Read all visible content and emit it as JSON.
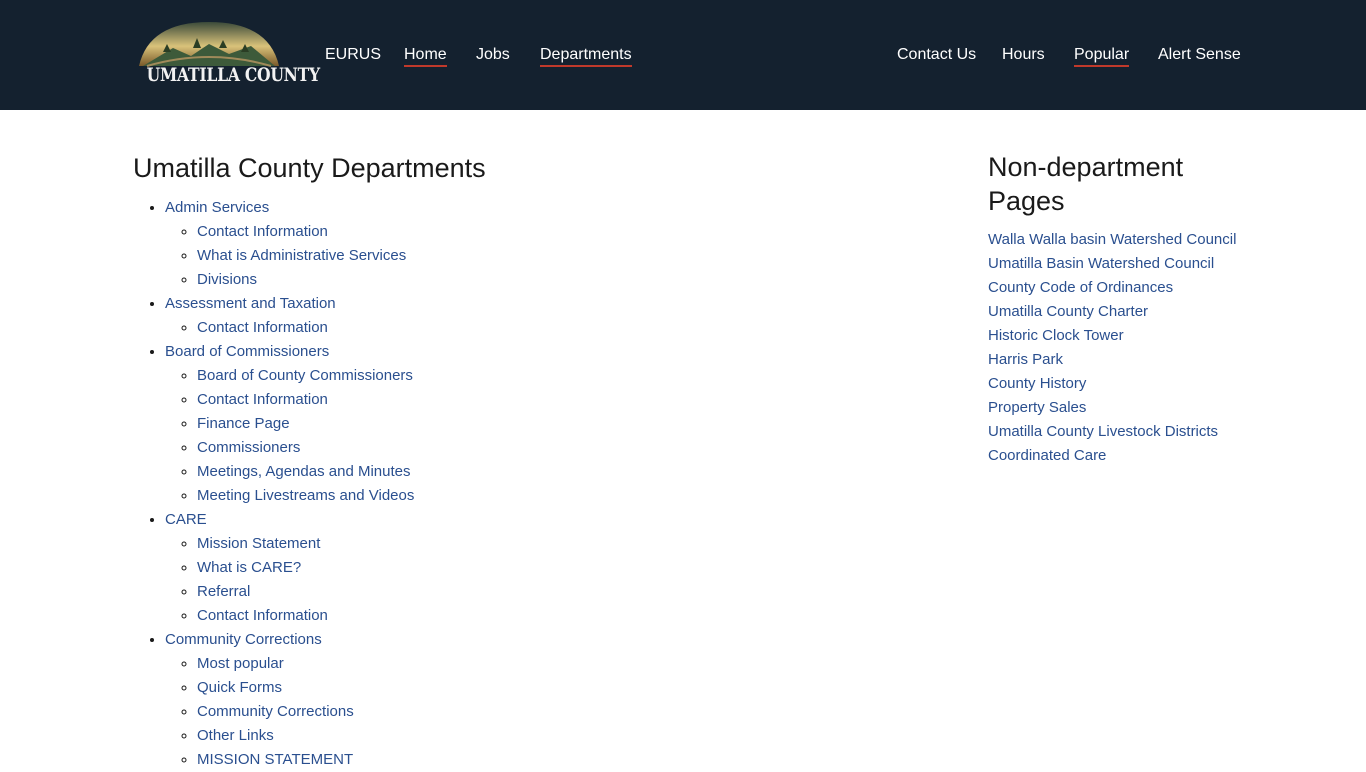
{
  "header": {
    "logo_text": "UMATILLA COUNTY",
    "nav_left": [
      {
        "label": "EURUS",
        "active": false
      },
      {
        "label": "Home",
        "active": true
      },
      {
        "label": "Jobs",
        "active": false
      },
      {
        "label": "Departments",
        "active": true
      }
    ],
    "nav_right": [
      {
        "label": "Contact Us",
        "active": false
      },
      {
        "label": "Hours",
        "active": false
      },
      {
        "label": "Popular",
        "active": true
      },
      {
        "label": "Alert Sense",
        "active": false
      }
    ],
    "colors": {
      "background": "#14212f",
      "active_underline": "#c0392b"
    }
  },
  "main": {
    "title": "Umatilla County Departments",
    "departments": [
      {
        "name": "Admin Services",
        "children": [
          "Contact Information",
          "What is Administrative Services",
          "Divisions"
        ]
      },
      {
        "name": "Assessment and Taxation",
        "children": [
          "Contact Information"
        ]
      },
      {
        "name": "Board of Commissioners",
        "children": [
          "Board of County Commissioners",
          "Contact Information",
          "Finance Page",
          "Commissioners",
          "Meetings, Agendas and Minutes",
          "Meeting Livestreams and Videos"
        ]
      },
      {
        "name": "CARE",
        "children": [
          "Mission Statement",
          "What is CARE?",
          "Referral",
          "Contact Information"
        ]
      },
      {
        "name": "Community Corrections",
        "children": [
          "Most popular",
          "Quick Forms",
          "Community Corrections",
          "Other Links",
          "MISSION STATEMENT"
        ]
      }
    ]
  },
  "sidebar": {
    "title": "Non-department Pages",
    "links": [
      "Walla Walla basin Watershed Council",
      "Umatilla Basin Watershed Council",
      "County Code of Ordinances",
      "Umatilla County Charter",
      "Historic Clock Tower",
      "Harris Park",
      "County History",
      "Property Sales",
      "Umatilla County Livestock Districts",
      "Coordinated Care"
    ]
  },
  "colors": {
    "link": "#2a4f8f",
    "text": "#1a1a1a"
  }
}
